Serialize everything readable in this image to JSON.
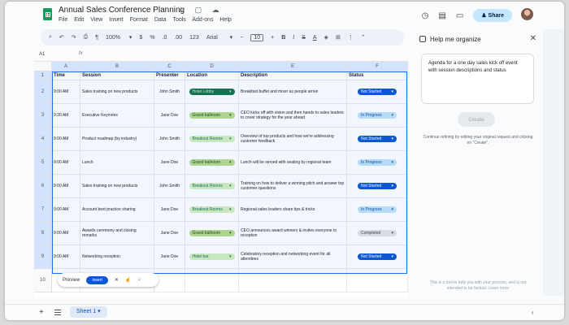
{
  "app": {
    "title": "Annual Sales Conference Planning",
    "title_icons": "☆ ▢ ☁",
    "menu": [
      "File",
      "Edit",
      "View",
      "Insert",
      "Format",
      "Data",
      "Tools",
      "Add-ons",
      "Help"
    ],
    "share_label": "Share"
  },
  "toolbar": {
    "undo": "↶",
    "redo": "↷",
    "print": "⎙",
    "paint": "🖌",
    "zoom": "100%",
    "currency": "$",
    "percent": "%",
    "dec_less": ".0",
    "dec_more": ".00",
    "number_format": "123",
    "font": "Arial",
    "font_size": "10",
    "minus": "−",
    "plus": "+",
    "bold": "B",
    "italic": "I",
    "strike": "S",
    "text_color": "A"
  },
  "formula_bar": {
    "name_box": "A1",
    "fx": "fx"
  },
  "grid": {
    "col_letters": [
      "A",
      "B",
      "C",
      "D",
      "E",
      "F"
    ],
    "row_numbers": [
      "1",
      "2",
      "3",
      "4",
      "5",
      "6",
      "7",
      "8",
      "9",
      "10"
    ],
    "headers": [
      "Time",
      "Session",
      "Presenter",
      "Location",
      "Description",
      "Status"
    ],
    "rows": [
      {
        "time": "9:00 AM",
        "session": "Sales training on new products",
        "presenter": "John Smith",
        "location": "Hotel Lobby",
        "loc_style": "green-dark",
        "description": "Breakfast buffet and mixer as people arrive",
        "status": "Not Started",
        "status_style": "blue"
      },
      {
        "time": "9:30 AM",
        "session": "Executive Keynotes",
        "presenter": "Jane Doe",
        "location": "Grand ballroom",
        "loc_style": "green-mid",
        "description": "CEO kicks off with vision and then hands to sales leaders to cover strategy for the year ahead",
        "status": "In Progress",
        "status_style": "lblue"
      },
      {
        "time": "9:00 AM",
        "session": "Product roadmap (by industry)",
        "presenter": "John Smith",
        "location": "Breakout Rooms",
        "loc_style": "green-light",
        "description": "Overview of top products and how we're addressing customer feedback",
        "status": "Not Started",
        "status_style": "blue"
      },
      {
        "time": "9:00 AM",
        "session": "Lunch",
        "presenter": "Jane Doe",
        "location": "Grand ballroom",
        "loc_style": "green-mid",
        "description": "Lunch will be served with seating by regional team",
        "status": "In Progress",
        "status_style": "lblue"
      },
      {
        "time": "9:00 AM",
        "session": "Sales training on new products",
        "presenter": "John Smith",
        "location": "Breakout Rooms",
        "loc_style": "green-light",
        "description": "Training on how to deliver a winning pitch and answer top customer questions",
        "status": "Not Started",
        "status_style": "blue"
      },
      {
        "time": "9:00 AM",
        "session": "Account best practice sharing",
        "presenter": "Jane Doe",
        "location": "Breakout Rooms",
        "loc_style": "green-light",
        "description": "Regional sales leaders share tips & tricks",
        "status": "In Progress",
        "status_style": "lblue"
      },
      {
        "time": "9:00 AM",
        "session": "Awards ceremony and closing remarks",
        "presenter": "Jane Doe",
        "location": "Grand ballroom",
        "loc_style": "green-mid",
        "description": "CEO announces award winners & invites everyone to reception",
        "status": "Completed",
        "status_style": "gray"
      },
      {
        "time": "9:00 AM",
        "session": "Networking reception",
        "presenter": "Jane Doe",
        "location": "Hotel bar",
        "loc_style": "green-light",
        "description": "Celebratory reception and networking event for all attendees",
        "status": "Not Started",
        "status_style": "blue"
      }
    ]
  },
  "preview_bar": {
    "preview_label": "Preview",
    "insert_label": "Insert",
    "close": "✕",
    "thumbs_up": "👍",
    "thumbs_down": "👎"
  },
  "sidebar": {
    "title": "Help me organize",
    "close": "✕",
    "prompt": "Agenda for a one day sales kick off event with session descriptions and status",
    "create_label": "Create",
    "hint": "Continue refining by editing your original request and clicking on \"Create\".",
    "footer": "This is a tool to help you with your process, and is not intended to be factual. Learn more"
  },
  "bottom": {
    "plus": "+",
    "sheet_tab": "Sheet 1 ▾",
    "collapse": "‹"
  },
  "colors": {
    "accent": "#0b57d0",
    "share_bg": "#c2e7ff",
    "sheets_green": "#0f9d58"
  }
}
